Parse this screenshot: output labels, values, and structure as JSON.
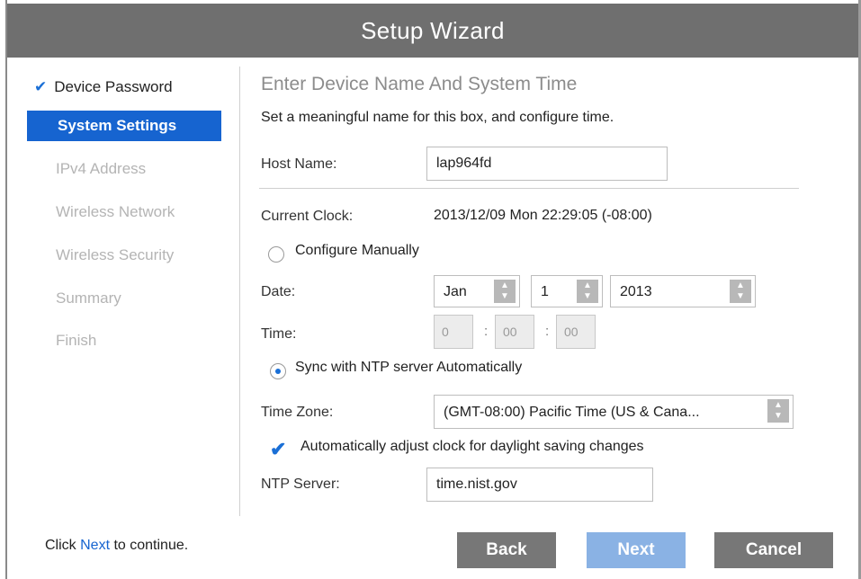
{
  "window": {
    "title": "Setup Wizard"
  },
  "sidebar": {
    "items": [
      {
        "label": "Device Password",
        "state": "done"
      },
      {
        "label": "System Settings",
        "state": "active"
      },
      {
        "label": "IPv4 Address",
        "state": "disabled"
      },
      {
        "label": "Wireless Network",
        "state": "disabled"
      },
      {
        "label": "Wireless Security",
        "state": "disabled"
      },
      {
        "label": "Summary",
        "state": "disabled"
      },
      {
        "label": "Finish",
        "state": "disabled"
      }
    ]
  },
  "main": {
    "heading": "Enter Device Name And System Time",
    "subtext": "Set a meaningful name for this box, and configure time.",
    "host_name": {
      "label": "Host Name:",
      "value": "lap964fd"
    },
    "current_clock": {
      "label": "Current Clock:",
      "value": "2013/12/09 Mon 22:29:05 (-08:00)"
    },
    "configure_manually": {
      "label": "Configure Manually",
      "selected": false
    },
    "date": {
      "label": "Date:",
      "month": "Jan",
      "day": "1",
      "year": "2013"
    },
    "time": {
      "label": "Time:",
      "hour": "0",
      "minute": "00",
      "second": "00"
    },
    "sync_ntp": {
      "label": "Sync with NTP server Automatically",
      "selected": true
    },
    "time_zone": {
      "label": "Time Zone:",
      "value": "(GMT-08:00) Pacific Time (US & Cana..."
    },
    "dst": {
      "label": "Automatically adjust clock for daylight saving changes",
      "checked": true
    },
    "ntp_server": {
      "label": "NTP Server:",
      "value": "time.nist.gov"
    }
  },
  "footer": {
    "note_prefix": "Click ",
    "note_link": "Next",
    "note_suffix": " to continue.",
    "back_label": "Back",
    "next_label": "Next",
    "cancel_label": "Cancel"
  },
  "colors": {
    "accent": "#1664d0",
    "title_bar": "#6f6f6f",
    "button_gray": "#777777",
    "button_next": "#8ab2e4"
  },
  "icons": {
    "check": "check-icon",
    "spinner": "spinner-arrows-icon"
  }
}
